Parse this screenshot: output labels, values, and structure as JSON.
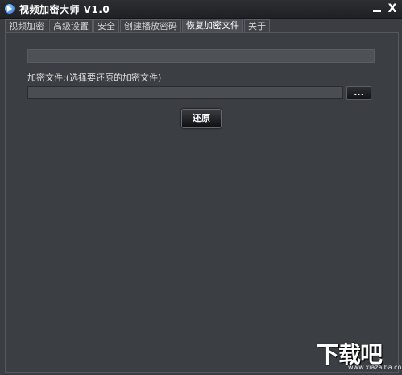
{
  "window": {
    "title": "视频加密大师 V1.0",
    "minimize_label": "",
    "close_label": "X"
  },
  "tabs": [
    {
      "label": "视频加密",
      "active": false
    },
    {
      "label": "高级设置",
      "active": false
    },
    {
      "label": "安全",
      "active": false
    },
    {
      "label": "创建播放密码",
      "active": false
    },
    {
      "label": "恢复加密文件",
      "active": true
    },
    {
      "label": "关于",
      "active": false
    }
  ],
  "restore_panel": {
    "progress": 0,
    "file_label": "加密文件:(选择要还原的加密文件)",
    "file_path_value": "",
    "browse_label": "...",
    "restore_label": "还原"
  },
  "watermark": {
    "logo_text": "下载吧",
    "url_text": "www.xiazaiba.com"
  },
  "colors": {
    "background": "#3a3d42",
    "titlebar": "#202124",
    "text": "#d7d7d7"
  }
}
